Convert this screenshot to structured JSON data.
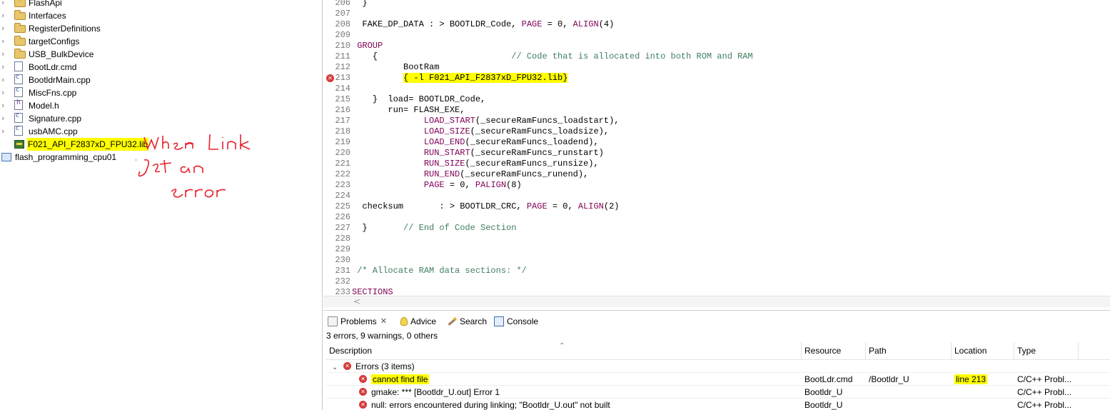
{
  "explorer": {
    "items": [
      {
        "label": "FlashApi",
        "kind": "folder",
        "expandable": true,
        "highlighted": false
      },
      {
        "label": "Interfaces",
        "kind": "folder",
        "expandable": true,
        "highlighted": false
      },
      {
        "label": "RegisterDefinitions",
        "kind": "folder",
        "expandable": true,
        "highlighted": false
      },
      {
        "label": "targetConfigs",
        "kind": "folder",
        "expandable": true,
        "highlighted": false
      },
      {
        "label": "USB_BulkDevice",
        "kind": "folder",
        "expandable": true,
        "highlighted": false
      },
      {
        "label": "BootLdr.cmd",
        "kind": "file",
        "expandable": true,
        "highlighted": false
      },
      {
        "label": "BootldrMain.cpp",
        "kind": "cpp",
        "expandable": true,
        "highlighted": false
      },
      {
        "label": "MiscFns.cpp",
        "kind": "cpp",
        "expandable": true,
        "highlighted": false
      },
      {
        "label": "Model.h",
        "kind": "h",
        "expandable": true,
        "highlighted": false
      },
      {
        "label": "Signature.cpp",
        "kind": "cpp",
        "expandable": true,
        "highlighted": false
      },
      {
        "label": "usbAMC.cpp",
        "kind": "cpp",
        "expandable": true,
        "highlighted": false
      },
      {
        "label": "F021_API_F2837xD_FPU32.lib",
        "kind": "lib",
        "expandable": false,
        "highlighted": true
      }
    ],
    "project": {
      "label": "flash_programming_cpu01",
      "kind": "project"
    },
    "annotation": {
      "lines": [
        "when Link",
        "get an",
        "error"
      ],
      "color": "#e8202a"
    }
  },
  "editor": {
    "lines": [
      {
        "n": "206",
        "parts": [
          {
            "t": "  }",
            "c": ""
          }
        ]
      },
      {
        "n": "207",
        "parts": []
      },
      {
        "n": "208",
        "parts": [
          {
            "t": "  FAKE_DP_DATA : > BOOTLDR_Code, ",
            "c": ""
          },
          {
            "t": "PAGE",
            "c": "kw"
          },
          {
            "t": " = 0, ",
            "c": ""
          },
          {
            "t": "ALIGN",
            "c": "kw"
          },
          {
            "t": "(4)",
            "c": ""
          }
        ]
      },
      {
        "n": "209",
        "parts": []
      },
      {
        "n": "210",
        "parts": [
          {
            "t": " GROUP",
            "c": "kw"
          }
        ]
      },
      {
        "n": "211",
        "parts": [
          {
            "t": "    {                          ",
            "c": ""
          },
          {
            "t": "// Code that is allocated into both ROM and RAM",
            "c": "cm"
          }
        ]
      },
      {
        "n": "212",
        "parts": [
          {
            "t": "          BootRam",
            "c": ""
          }
        ]
      },
      {
        "n": "213",
        "parts": [
          {
            "t": "          ",
            "c": ""
          },
          {
            "t": "{ -l F021_API_F2837xD_FPU32.lib}",
            "c": "hl"
          }
        ],
        "error": true
      },
      {
        "n": "214",
        "parts": []
      },
      {
        "n": "215",
        "parts": [
          {
            "t": "    }  load= BOOTLDR_Code,",
            "c": ""
          }
        ]
      },
      {
        "n": "216",
        "parts": [
          {
            "t": "       run= FLASH_EXE,",
            "c": ""
          }
        ]
      },
      {
        "n": "217",
        "parts": [
          {
            "t": "              ",
            "c": ""
          },
          {
            "t": "LOAD_START",
            "c": "kw"
          },
          {
            "t": "(_secureRamFuncs_loadstart),",
            "c": ""
          }
        ]
      },
      {
        "n": "218",
        "parts": [
          {
            "t": "              ",
            "c": ""
          },
          {
            "t": "LOAD_SIZE",
            "c": "kw"
          },
          {
            "t": "(_secureRamFuncs_loadsize),",
            "c": ""
          }
        ]
      },
      {
        "n": "219",
        "parts": [
          {
            "t": "              ",
            "c": ""
          },
          {
            "t": "LOAD_END",
            "c": "kw"
          },
          {
            "t": "(_secureRamFuncs_loadend),",
            "c": ""
          }
        ]
      },
      {
        "n": "220",
        "parts": [
          {
            "t": "              ",
            "c": ""
          },
          {
            "t": "RUN_START",
            "c": "kw"
          },
          {
            "t": "(_secureRamFuncs_runstart)",
            "c": ""
          }
        ]
      },
      {
        "n": "221",
        "parts": [
          {
            "t": "              ",
            "c": ""
          },
          {
            "t": "RUN_SIZE",
            "c": "kw"
          },
          {
            "t": "(_secureRamFuncs_runsize),",
            "c": ""
          }
        ]
      },
      {
        "n": "222",
        "parts": [
          {
            "t": "              ",
            "c": ""
          },
          {
            "t": "RUN_END",
            "c": "kw"
          },
          {
            "t": "(_secureRamFuncs_runend),",
            "c": ""
          }
        ]
      },
      {
        "n": "223",
        "parts": [
          {
            "t": "              ",
            "c": ""
          },
          {
            "t": "PAGE",
            "c": "kw"
          },
          {
            "t": " = 0, ",
            "c": ""
          },
          {
            "t": "PALIGN",
            "c": "kw"
          },
          {
            "t": "(8)",
            "c": ""
          }
        ]
      },
      {
        "n": "224",
        "parts": []
      },
      {
        "n": "225",
        "parts": [
          {
            "t": "  checksum       : > BOOTLDR_CRC, ",
            "c": ""
          },
          {
            "t": "PAGE",
            "c": "kw"
          },
          {
            "t": " = 0, ",
            "c": ""
          },
          {
            "t": "ALIGN",
            "c": "kw"
          },
          {
            "t": "(2)",
            "c": ""
          }
        ]
      },
      {
        "n": "226",
        "parts": []
      },
      {
        "n": "227",
        "parts": [
          {
            "t": "  }       ",
            "c": ""
          },
          {
            "t": "// End of Code Section",
            "c": "cm"
          }
        ]
      },
      {
        "n": "228",
        "parts": []
      },
      {
        "n": "229",
        "parts": []
      },
      {
        "n": "230",
        "parts": []
      },
      {
        "n": "231",
        "parts": [
          {
            "t": " ",
            "c": ""
          },
          {
            "t": "/* Allocate RAM data sections: */",
            "c": "cm"
          }
        ]
      },
      {
        "n": "232",
        "parts": []
      },
      {
        "n": "233",
        "parts": [
          {
            "t": "SECTIONS",
            "c": "kw"
          }
        ]
      }
    ],
    "scroll_arrow": "<"
  },
  "problems": {
    "tabs": [
      {
        "label": "Problems",
        "icon": "problems-icon",
        "active": true,
        "close": "✕"
      },
      {
        "label": "Advice",
        "icon": "lightbulb-icon",
        "active": false
      },
      {
        "label": "Search",
        "icon": "search-wand-icon",
        "active": false
      },
      {
        "label": "Console",
        "icon": "console-icon",
        "active": false
      }
    ],
    "summary": "3 errors, 9 warnings, 0 others",
    "columns": [
      "Description",
      "Resource",
      "Path",
      "Location",
      "Type"
    ],
    "group": {
      "label": "Errors (3 items)"
    },
    "rows": [
      {
        "description": "cannot find file",
        "resource": "BootLdr.cmd",
        "path": "/Bootldr_U",
        "location": "line 213",
        "type": "C/C++ Probl...",
        "highlight_description": true,
        "highlight_location": true
      },
      {
        "description": "gmake: *** [Bootldr_U.out] Error 1",
        "resource": "Bootldr_U",
        "path": "",
        "location": "",
        "type": "C/C++ Probl...",
        "highlight_description": false,
        "highlight_location": false
      },
      {
        "description": "null: errors encountered during linking; \"Bootldr_U.out\" not built",
        "resource": "Bootldr_U",
        "path": "",
        "location": "",
        "type": "C/C++ Probl...",
        "highlight_description": false,
        "highlight_location": false
      }
    ]
  },
  "colors": {
    "highlight": "#ffff00",
    "error": "#d53a3a",
    "keyword": "#7f0055",
    "comment": "#3f7f5f"
  }
}
